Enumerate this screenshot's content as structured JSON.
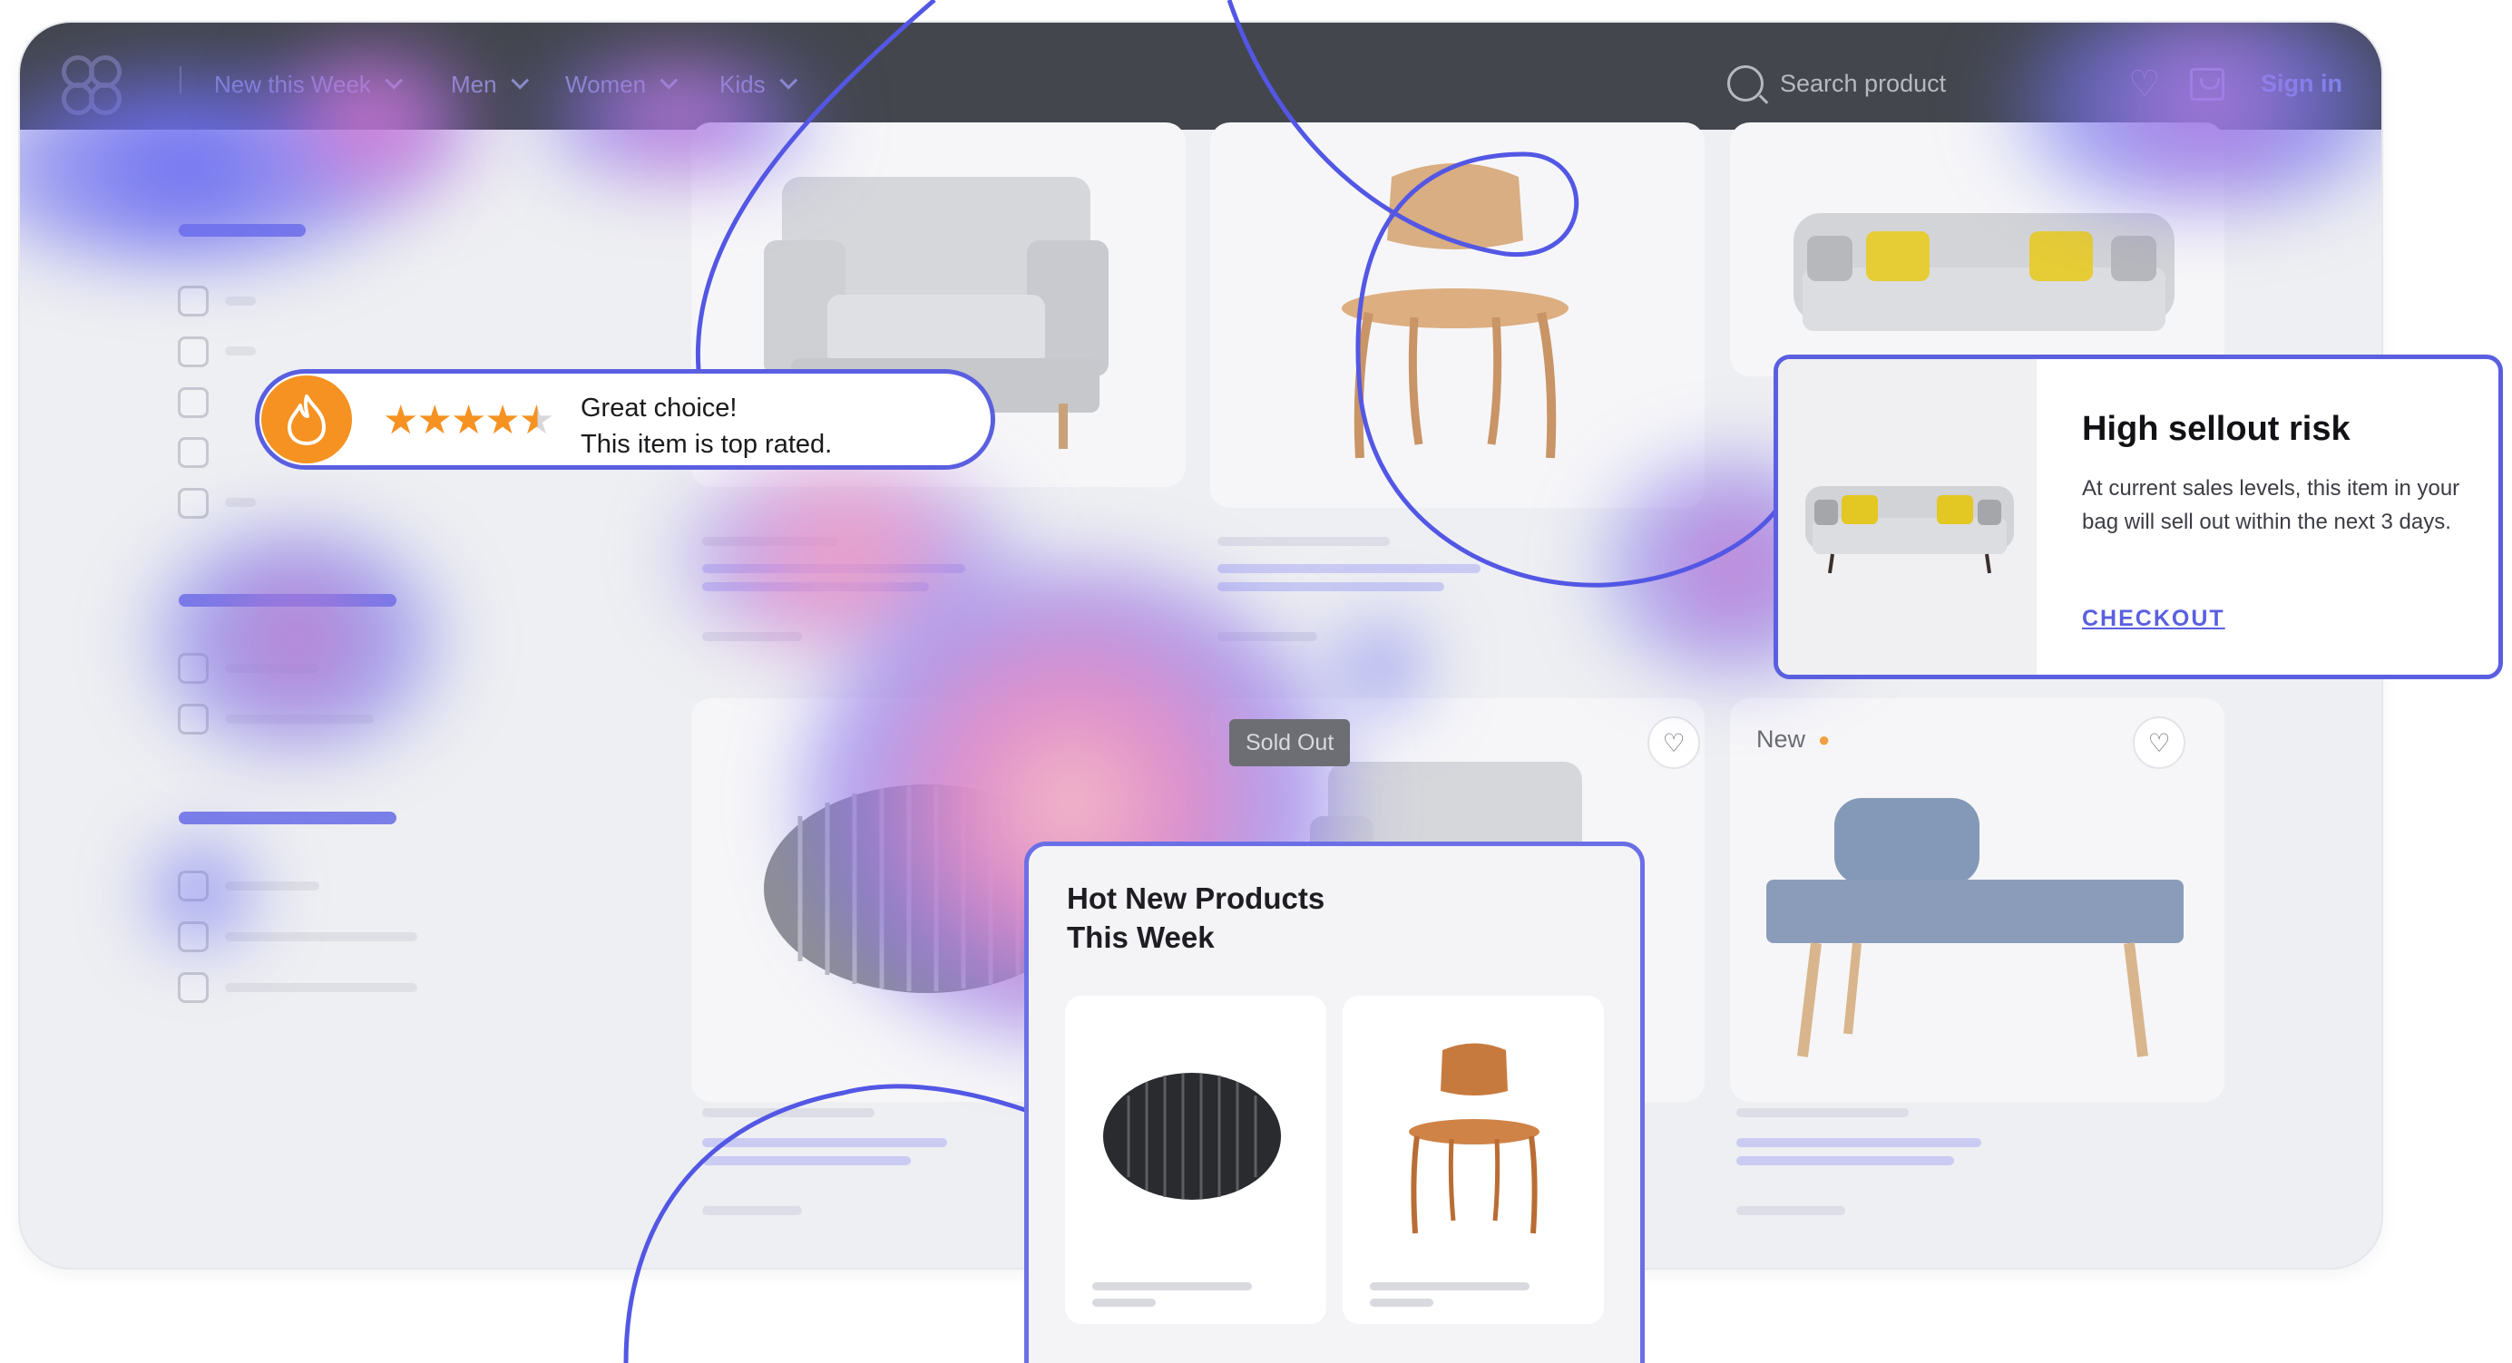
{
  "nav": {
    "items": [
      {
        "label": "New this Week"
      },
      {
        "label": "Men"
      },
      {
        "label": "Women"
      },
      {
        "label": "Kids"
      }
    ],
    "search_placeholder": "Search product",
    "signin_label": "Sign in",
    "icons": [
      "logo",
      "chevron-down-icon",
      "search-icon",
      "heart-icon",
      "bag-icon"
    ]
  },
  "badges": {
    "sold_out": "Sold Out",
    "new": "New"
  },
  "rating_popup": {
    "rating": 4.5,
    "max": 5,
    "line1": "Great choice!",
    "line2": "This item is top rated."
  },
  "sellout_popup": {
    "title": "High sellout risk",
    "body": "At current sales levels, this item in your bag will sell out within the next 3 days.",
    "cta": "CHECKOUT"
  },
  "hot_products": {
    "title": "Hot New Products This Week"
  },
  "colors": {
    "accent": "#5a5fe0",
    "topbar": "#43464d",
    "fire": "#f59222"
  }
}
